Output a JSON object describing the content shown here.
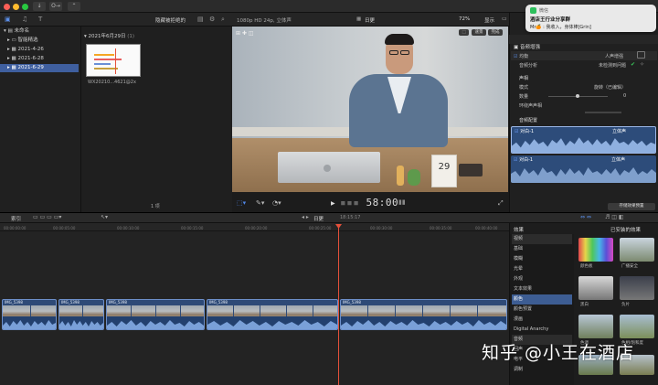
{
  "toolbar": {
    "btn1": "↓",
    "btn2": "O→",
    "btn3": "⌃"
  },
  "library": {
    "root": "未命名",
    "items": [
      {
        "label": "智能精选"
      },
      {
        "label": "2021-4-26"
      },
      {
        "label": "2021-6-28"
      },
      {
        "label": "2021-6-29"
      }
    ]
  },
  "browser": {
    "filter": "隐藏被拒绝的",
    "date_header": "2021年6月29日",
    "date_count": "(1)",
    "clip_name": "WX20210...4621@2x",
    "footer": "1 项"
  },
  "viewer": {
    "format": "1080p HD 24p, 立体声",
    "project": "日更",
    "zoom": "72%",
    "display": "显示",
    "badge_left": "速景",
    "badge_right": "完成",
    "timecode": "58:00",
    "calendar_num": "29"
  },
  "inspector": {
    "section1": "音频增强",
    "eq_label": "均衡",
    "eq_value": "人声增强",
    "analysis_label": "音频分析",
    "analysis_value": "未检测到问题",
    "section2": "声相",
    "mode_label": "模式",
    "mode_value": "旋转（已编辑）",
    "amount_label": "数量",
    "amount_value": "0",
    "surround_label": "环绕声声相",
    "section3": "音频配置",
    "comp1_name": "对白-1",
    "comp1_mode": "立体声",
    "comp2_name": "对白-1",
    "comp2_mode": "立体声",
    "save_btn": "存储效果预置"
  },
  "notification": {
    "app": "微信",
    "title": "酒店王行业分享群",
    "body": "Mr🍊 : 我收入，身体棒[Grin]"
  },
  "timeline": {
    "index": "索引",
    "project": "日更",
    "duration": "18:15:17",
    "ruler": [
      "00:00:00:00",
      "00:00:05:00",
      "00:00:10:00",
      "00:00:15:00",
      "00:00:20:00",
      "00:00:25:00",
      "00:00:30:00",
      "00:00:35:00",
      "00:00:40:00",
      "00:00:45:00",
      "00:00:50:00",
      "00:00:55:00",
      "00:01:00:00",
      "00:01:05:00"
    ],
    "clips": [
      {
        "label": "IMG_5398"
      },
      {
        "label": "IMG_5398"
      },
      {
        "label": "IMG_5398"
      },
      {
        "label": "IMG_5398"
      },
      {
        "label": "IMG_5398"
      },
      {
        "label": "IMG_5398"
      }
    ]
  },
  "effects": {
    "header": "效果",
    "installed": "已安装的效果",
    "categories": [
      "视频",
      "基础",
      "模糊",
      "光晕",
      "外观",
      "文本效果",
      "颜色",
      "颜色预置",
      "漫画",
      "Digital Anarchy",
      "音频",
      "回声",
      "电平",
      "调制"
    ],
    "tiles": [
      {
        "label": "颜色板"
      },
      {
        "label": "广播安全"
      },
      {
        "label": "黑白"
      },
      {
        "label": "负片"
      },
      {
        "label": "色调"
      },
      {
        "label": "色相/饱和度"
      }
    ]
  },
  "watermark": "知乎 @小王在酒店",
  "colors": {
    "accent": "#3f5f9f",
    "playhead": "#e4503a"
  }
}
